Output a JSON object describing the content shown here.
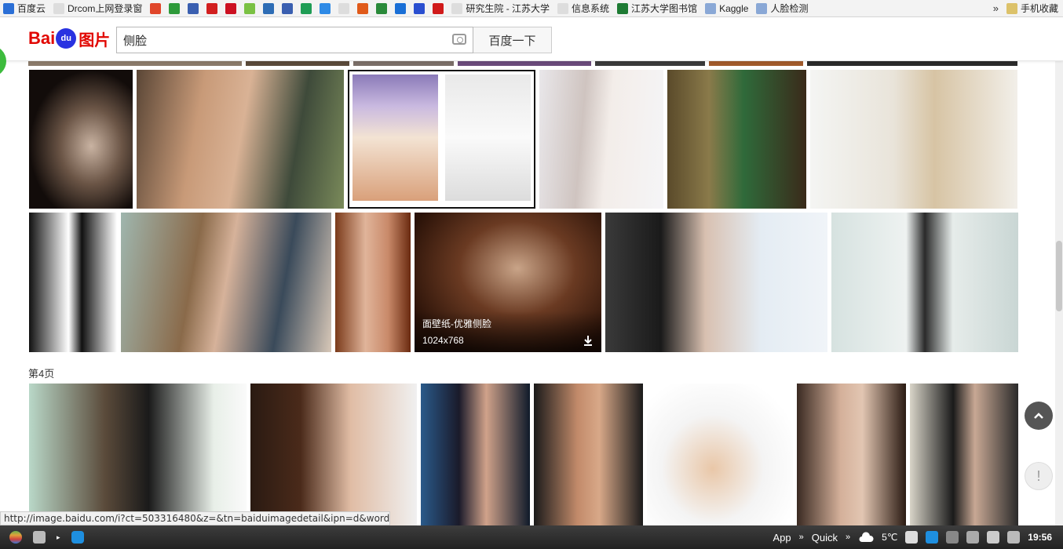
{
  "bookmarks": [
    {
      "label": "百度云",
      "color": "#2b6fd6"
    },
    {
      "label": "Drcom上网登录窗",
      "color": "#dddddd"
    },
    {
      "label": "",
      "color": "#e0462a"
    },
    {
      "label": "",
      "color": "#2e9a3a"
    },
    {
      "label": "",
      "color": "#3a5fb0"
    },
    {
      "label": "",
      "color": "#d21f1f"
    },
    {
      "label": "",
      "color": "#cc1122"
    },
    {
      "label": "",
      "color": "#7ac143"
    },
    {
      "label": "",
      "color": "#2e6db5"
    },
    {
      "label": "",
      "color": "#3a5fb0"
    },
    {
      "label": "",
      "color": "#1f9d55"
    },
    {
      "label": "",
      "color": "#2e8ae6"
    },
    {
      "label": "",
      "color": "#dddddd"
    },
    {
      "label": "",
      "color": "#e05a1a"
    },
    {
      "label": "",
      "color": "#2a8a3a"
    },
    {
      "label": "",
      "color": "#1a6fd6"
    },
    {
      "label": "",
      "color": "#2a4fd0"
    },
    {
      "label": "",
      "color": "#d01a1a"
    },
    {
      "label": "研究生院 - 江苏大学",
      "color": "#dddddd"
    },
    {
      "label": "信息系统",
      "color": "#dddddd"
    },
    {
      "label": "江苏大学图书馆",
      "color": "#1e7b34"
    },
    {
      "label": "Kaggle",
      "color": "#8aa8d6"
    },
    {
      "label": "人脸检测",
      "color": "#8aa8d6"
    }
  ],
  "bookmarks_more": "»",
  "mobile_bookmarks": "手机收藏",
  "header": {
    "logo_bai": "Bai",
    "logo_du": "du",
    "logo_pic": "图片",
    "search_value": "侧脸",
    "search_button": "百度一下"
  },
  "hover_tile": {
    "title": "面壁纸-优雅侧脸",
    "size": "1024x768"
  },
  "page_label": "第4页",
  "status_url": "http://image.baidu.com/i?ct=503316480&z=&tn=baiduimagedetail&ipn=d&word=%E4...",
  "taskbar": {
    "app_label": "App",
    "quick_label": "Quick",
    "weather": "5℃",
    "time": "19:56"
  },
  "colors": {
    "brand_red": "#e10601",
    "brand_blue": "#2932e1"
  }
}
